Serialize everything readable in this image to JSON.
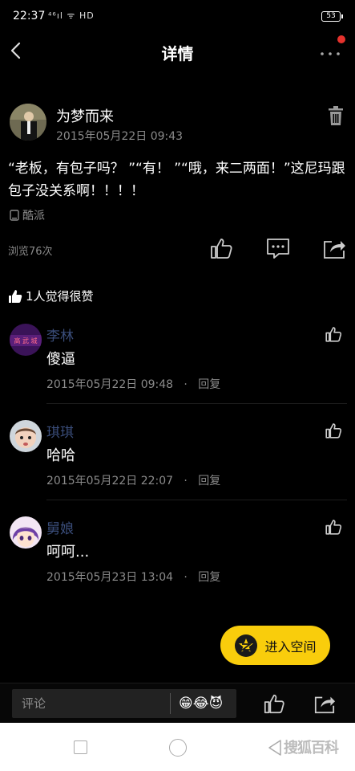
{
  "status_bar": {
    "time": "22:37",
    "signal": "⁴⁶ıl ᯤ HD",
    "battery": "53"
  },
  "nav": {
    "title": "详情"
  },
  "post": {
    "author": "为梦而来",
    "time": "2015年05月22日 09:43",
    "content": "“老板，有包子吗？ ”“有！ ”“哦，来二两面！”这尼玛跟包子没关系啊！！！！",
    "source": "酷派",
    "views": "浏览76次"
  },
  "likes_summary": "1人觉得很赞",
  "comments": [
    {
      "name": "李林",
      "text": "傻逼",
      "time": "2015年05月22日 09:48",
      "dot": "·",
      "reply": "回复",
      "avatar_text": "高 武 城"
    },
    {
      "name": "琪琪",
      "text": "哈哈",
      "time": "2015年05月22日 22:07",
      "dot": "·",
      "reply": "回复"
    },
    {
      "name": "舅娘",
      "text": "呵呵...",
      "time": "2015年05月23日 13:04",
      "dot": "·",
      "reply": "回复"
    }
  ],
  "space_button": {
    "label": "进入空间"
  },
  "bottom_bar": {
    "comment_placeholder": "评论",
    "emojis": "😁😂😈"
  },
  "watermark": "搜狐百科",
  "colors": {
    "accent": "#f9cd0c",
    "comment_name": "#3a4d7a",
    "background": "#000000",
    "muted": "#8a8a8a",
    "notify_dot": "#e5322d"
  }
}
